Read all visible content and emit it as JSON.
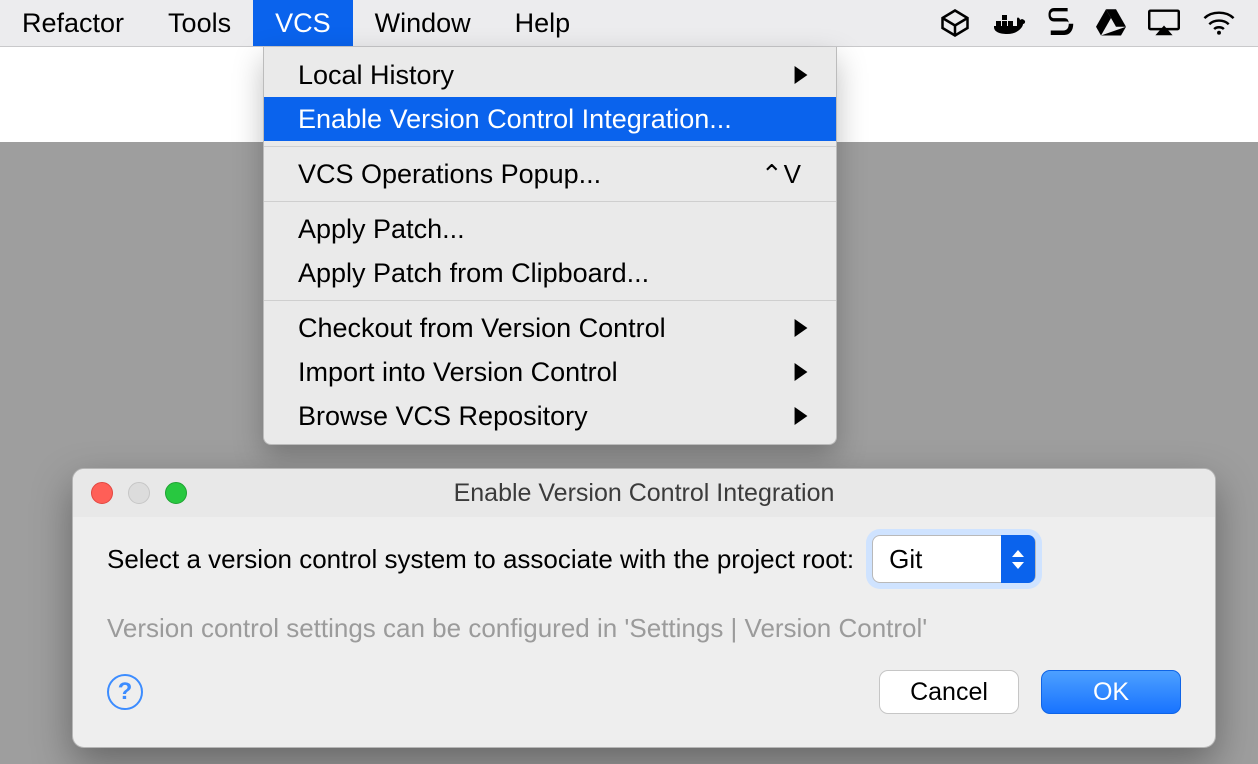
{
  "menubar": {
    "items": [
      {
        "label": "Refactor"
      },
      {
        "label": "Tools"
      },
      {
        "label": "VCS"
      },
      {
        "label": "Window"
      },
      {
        "label": "Help"
      }
    ]
  },
  "menubar_icons": [
    "cube-icon",
    "docker-icon",
    "s-icon",
    "drive-icon",
    "airplay-icon",
    "wifi-icon"
  ],
  "vcs_menu": {
    "items": [
      {
        "label": "Local History",
        "submenu": true
      },
      {
        "label": "Enable Version Control Integration..."
      },
      {
        "label": "VCS Operations Popup...",
        "shortcut": "⌃V"
      },
      {
        "label": "Apply Patch..."
      },
      {
        "label": "Apply Patch from Clipboard..."
      },
      {
        "label": "Checkout from Version Control",
        "submenu": true
      },
      {
        "label": "Import into Version Control",
        "submenu": true
      },
      {
        "label": "Browse VCS Repository",
        "submenu": true
      }
    ]
  },
  "dialog": {
    "title": "Enable Version Control Integration",
    "prompt": "Select a version control system to associate with the project root:",
    "select_value": "Git",
    "hint": "Version control settings can be configured in 'Settings | Version Control'",
    "help": "?",
    "cancel": "Cancel",
    "ok": "OK"
  }
}
